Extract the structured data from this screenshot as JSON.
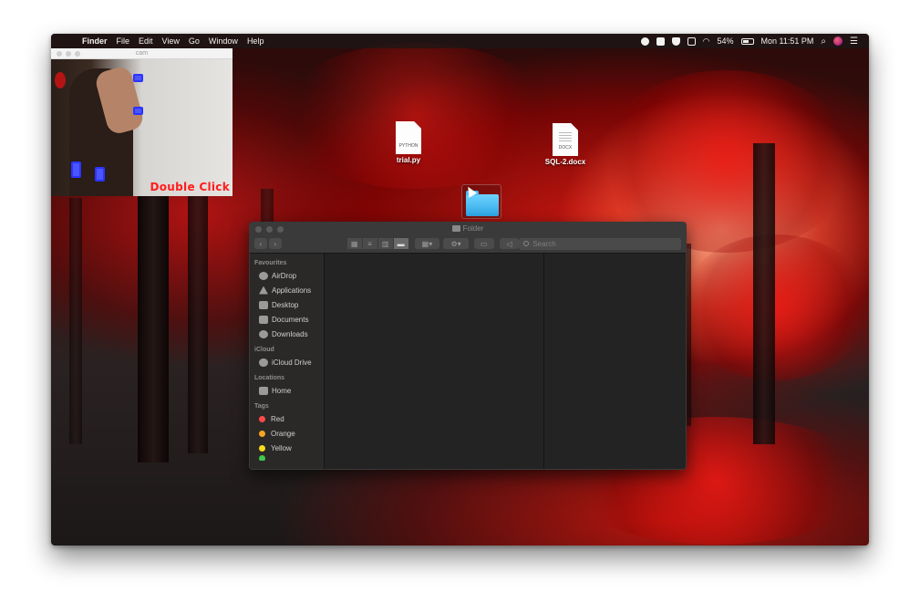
{
  "menubar": {
    "apple_icon": "apple-logo-icon",
    "app": "Finder",
    "items": [
      "File",
      "Edit",
      "View",
      "Go",
      "Window",
      "Help"
    ],
    "battery": "54%",
    "clock": "Mon 11:51 PM"
  },
  "cam_window": {
    "title": "cam",
    "gesture_text": "Double Click"
  },
  "desktop_icons": [
    {
      "name": "trial.py",
      "kind": "PYTHON"
    },
    {
      "name": "SQL-2.docx",
      "kind": "DOCX"
    }
  ],
  "finder": {
    "title": "Folder",
    "search_placeholder": "Search",
    "sidebar": {
      "favourites_label": "Favourites",
      "favourites": [
        {
          "label": "AirDrop",
          "icon": "airdrop-icon"
        },
        {
          "label": "Applications",
          "icon": "applications-icon"
        },
        {
          "label": "Desktop",
          "icon": "desktop-icon"
        },
        {
          "label": "Documents",
          "icon": "documents-icon"
        },
        {
          "label": "Downloads",
          "icon": "downloads-icon"
        }
      ],
      "icloud_label": "iCloud",
      "icloud": [
        {
          "label": "iCloud Drive",
          "icon": "cloud-icon"
        }
      ],
      "locations_label": "Locations",
      "locations": [
        {
          "label": "Home",
          "icon": "home-icon"
        }
      ],
      "tags_label": "Tags",
      "tags": [
        {
          "label": "Red",
          "color": "#ff4a4a"
        },
        {
          "label": "Orange",
          "color": "#f5a623"
        },
        {
          "label": "Yellow",
          "color": "#f5dd1e"
        }
      ]
    }
  }
}
